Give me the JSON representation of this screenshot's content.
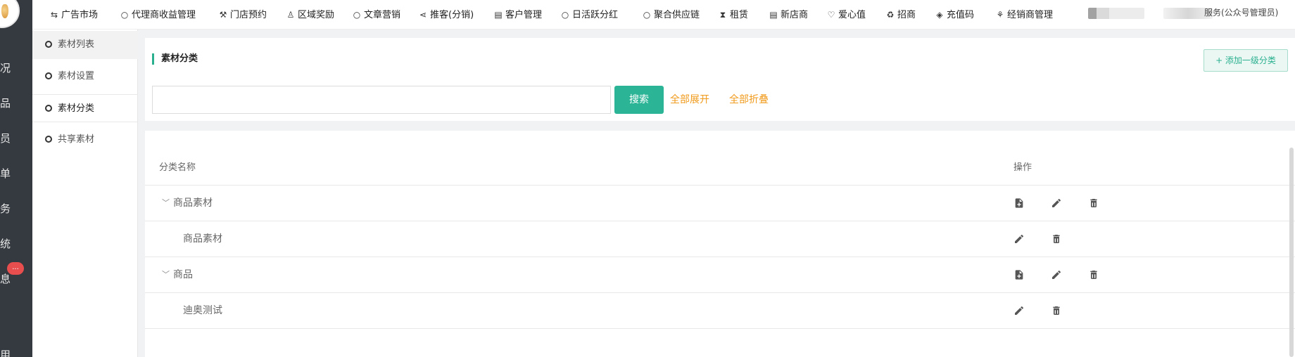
{
  "rail": {
    "items": [
      "况",
      "品",
      "员",
      "单",
      "务",
      "统",
      "息",
      "用"
    ],
    "badge": "..."
  },
  "topnav": {
    "items": [
      {
        "icon": "repeat-icon",
        "glyph": "⇆",
        "label": "广告市场"
      },
      {
        "icon": "circle-icon",
        "glyph": "○",
        "label": "代理商收益管理"
      },
      {
        "icon": "hammer-icon",
        "glyph": "⚒",
        "label": "门店预约"
      },
      {
        "icon": "person-icon",
        "glyph": "♙",
        "label": "区域奖励"
      },
      {
        "icon": "circle-icon",
        "glyph": "○",
        "label": "文章营销"
      },
      {
        "icon": "share-icon",
        "glyph": "⋖",
        "label": "推客(分销)"
      },
      {
        "icon": "book-icon",
        "glyph": "▤",
        "label": "客户管理"
      },
      {
        "icon": "circle-icon",
        "glyph": "○",
        "label": "日活跃分红"
      },
      {
        "icon": "circle-icon",
        "glyph": "○",
        "label": "聚合供应链"
      },
      {
        "icon": "hourglass-icon",
        "glyph": "⧗",
        "label": "租赁"
      },
      {
        "icon": "book-icon",
        "glyph": "▤",
        "label": "新店商"
      },
      {
        "icon": "heart-icon",
        "glyph": "♡",
        "label": "爱心值"
      },
      {
        "icon": "recycle-icon",
        "glyph": "♻",
        "label": "招商"
      },
      {
        "icon": "tag-icon",
        "glyph": "◈",
        "label": "充值码"
      },
      {
        "icon": "handshake-icon",
        "glyph": "⚘",
        "label": "经销商管理"
      }
    ],
    "admin_label": "服务(公众号管理员)"
  },
  "subnav": {
    "items": [
      {
        "label": "素材列表",
        "state": "active"
      },
      {
        "label": "素材设置",
        "state": ""
      },
      {
        "label": "素材分类",
        "state": "current"
      },
      {
        "label": "共享素材",
        "state": ""
      }
    ]
  },
  "header": {
    "title": "素材分类",
    "add_button": "+ 添加一级分类",
    "search": {
      "value": "",
      "placeholder": ""
    },
    "search_button": "搜索",
    "expand_all": "全部展开",
    "collapse_all": "全部折叠"
  },
  "table": {
    "columns": [
      "分类名称",
      "操作"
    ],
    "rows": [
      {
        "name": "商品素材",
        "level": 1,
        "actions": [
          "add-file-icon",
          "edit-icon",
          "delete-icon"
        ]
      },
      {
        "name": "商品素材",
        "level": 2,
        "actions": [
          "edit-icon",
          "delete-icon"
        ]
      },
      {
        "name": "商品",
        "level": 1,
        "actions": [
          "add-file-icon",
          "edit-icon",
          "delete-icon"
        ]
      },
      {
        "name": "迪奥测试",
        "level": 2,
        "actions": [
          "edit-icon",
          "delete-icon"
        ]
      }
    ]
  },
  "colors": {
    "accent": "#2bb596",
    "link": "#f09a1b",
    "rail_bg": "#353a40",
    "badge": "#e94e4e"
  }
}
